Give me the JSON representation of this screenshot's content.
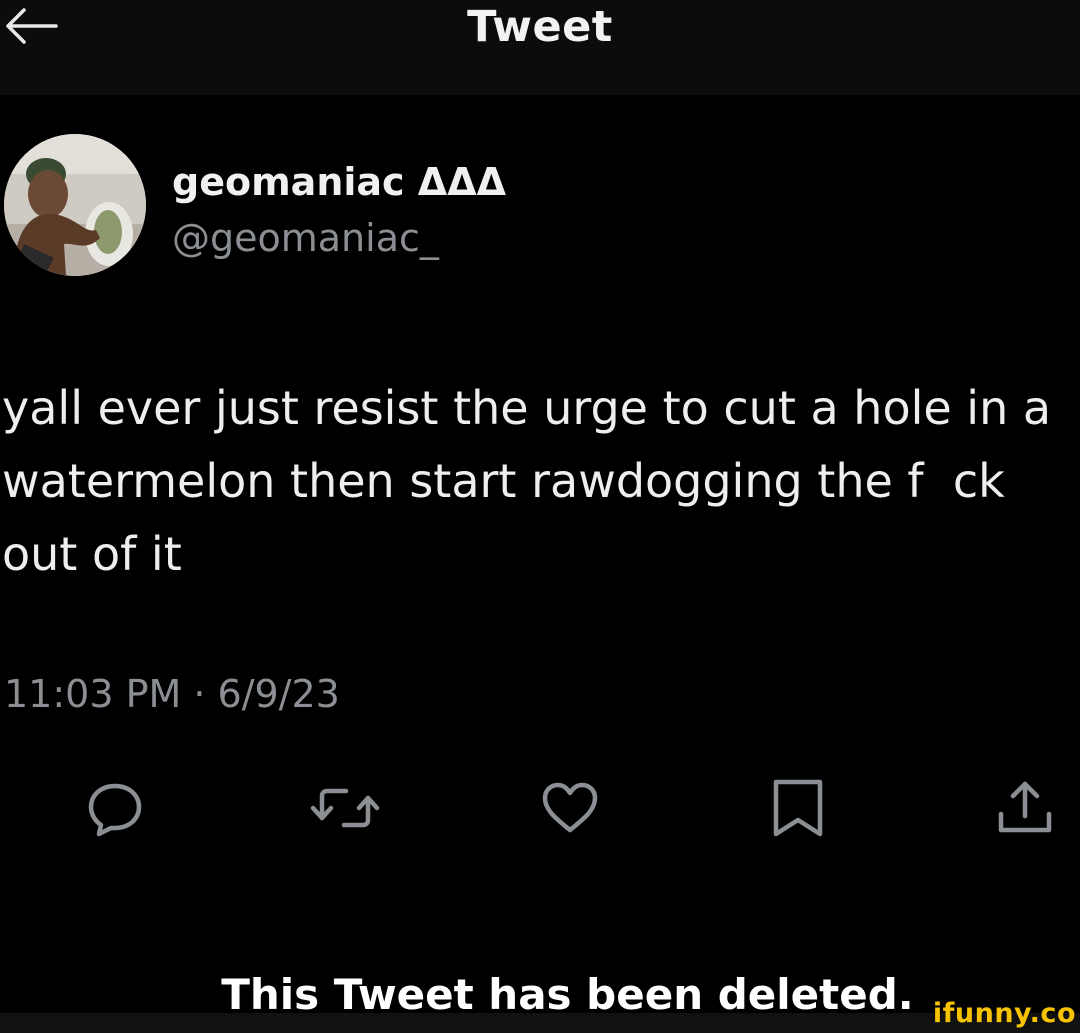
{
  "header": {
    "title": "Tweet",
    "back_icon": "arrow-left-icon"
  },
  "author": {
    "display_name": "geomaniac ΔΔΔ",
    "handle": "@geomaniac_",
    "avatar_icon": "avatar"
  },
  "tweet": {
    "text": "yall ever just resist the urge to cut a hole in a\nwatermelon then start rawdogging the f  ck\nout of it",
    "timestamp": "11:03 PM · 6/9/23"
  },
  "actions": [
    {
      "name": "reply",
      "icon": "reply-icon"
    },
    {
      "name": "retweet",
      "icon": "retweet-icon"
    },
    {
      "name": "like",
      "icon": "heart-icon"
    },
    {
      "name": "bookmark",
      "icon": "bookmark-icon"
    },
    {
      "name": "share",
      "icon": "share-icon"
    }
  ],
  "caption": "This Tweet has been deleted.",
  "watermark": "ifunny.co",
  "colors": {
    "background": "#000000",
    "text": "#eeeeee",
    "secondary_text": "#8b8f93",
    "icon": "#8b8f93",
    "watermark": "#f7c300"
  }
}
